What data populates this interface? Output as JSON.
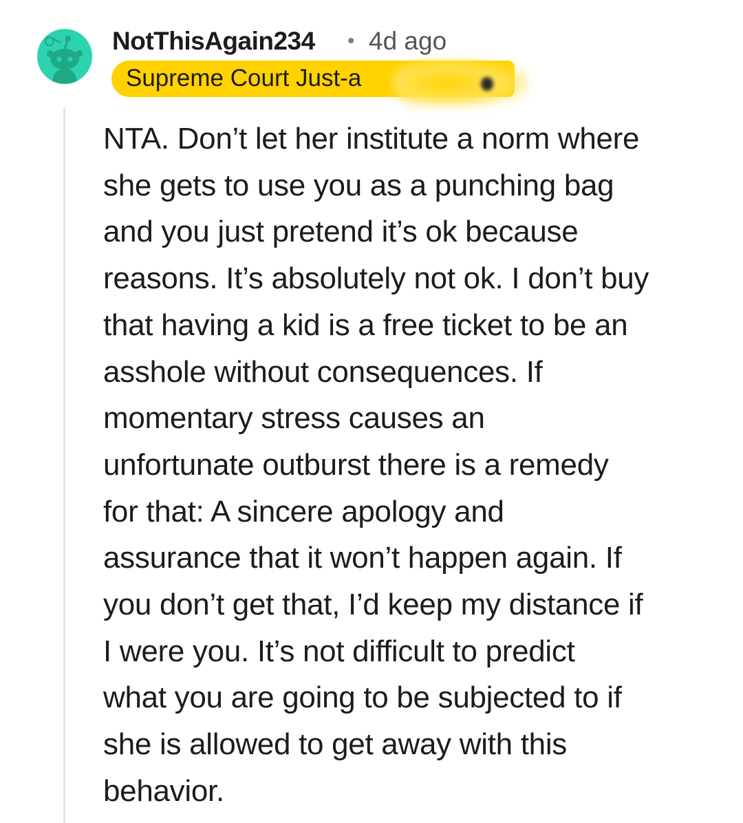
{
  "comment": {
    "author": "NotThisAgain234",
    "separator": "•",
    "timestamp": "4d ago",
    "flair": "Supreme Court Just-a",
    "avatar_icon": "snoo-avatar-icon",
    "avatar_color": "#2dd3ae",
    "flair_color": "#ffd200",
    "body": "NTA. Don’t let her institute a norm where\nshe gets to use you as a punching bag\nand you just pretend it’s ok because\nreasons. It’s absolutely not ok. I don’t buy\nthat having a kid is a free ticket to be an\nasshole without consequences. If\nmomentary stress causes an\nunfortunate outburst there is a remedy\nfor that: A sincere apology and\nassurance that it won’t happen again. If\nyou don’t get that, I’d keep my distance if\nI were you. It’s not difficult to predict\nwhat you are going to be subjected to if\nshe is allowed to get away with this\nbehavior."
  }
}
